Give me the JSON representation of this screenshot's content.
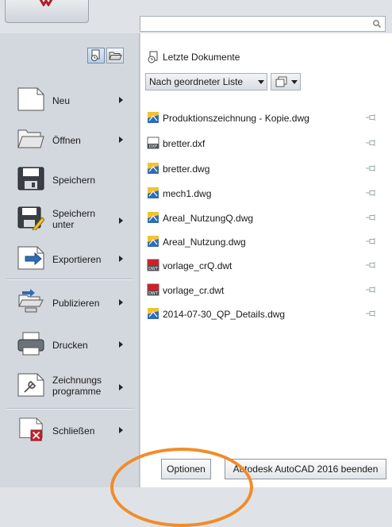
{
  "search": {
    "value": "",
    "placeholder": ""
  },
  "left_menu": {
    "items": [
      {
        "id": "new",
        "label": "Neu",
        "has_submenu": true
      },
      {
        "id": "open",
        "label": "Öffnen",
        "has_submenu": true
      },
      {
        "id": "save",
        "label": "Speichern",
        "has_submenu": false
      },
      {
        "id": "saveas",
        "label": "Speichern unter",
        "has_submenu": true
      },
      {
        "id": "export",
        "label": "Exportieren",
        "has_submenu": true
      },
      {
        "id": "publish",
        "label": "Publizieren",
        "has_submenu": true
      },
      {
        "id": "print",
        "label": "Drucken",
        "has_submenu": true
      },
      {
        "id": "drawingutils",
        "label": "Zeichnungs programme",
        "has_submenu": true
      },
      {
        "id": "close",
        "label": "Schließen",
        "has_submenu": true
      }
    ]
  },
  "recent": {
    "title": "Letzte Dokumente",
    "sort_option": "Nach geordneter Liste",
    "files": [
      {
        "name": "Produktionszeichnung - Kopie.dwg",
        "type": "dwg"
      },
      {
        "name": "bretter.dxf",
        "type": "dxf"
      },
      {
        "name": "bretter.dwg",
        "type": "dwg"
      },
      {
        "name": "mech1.dwg",
        "type": "dwg"
      },
      {
        "name": "Areal_NutzungQ.dwg",
        "type": "dwg"
      },
      {
        "name": "Areal_Nutzung.dwg",
        "type": "dwg"
      },
      {
        "name": "vorlage_crQ.dwt",
        "type": "dwt"
      },
      {
        "name": "vorlage_cr.dwt",
        "type": "dwt"
      },
      {
        "name": "2014-07-30_QP_Details.dwg",
        "type": "dwg"
      }
    ]
  },
  "footer": {
    "options_label": "Optionen",
    "exit_label": "Autodesk AutoCAD 2016 beenden"
  },
  "colors": {
    "highlight": "#f28c28",
    "dwt_red": "#c8232c",
    "dwg_blue": "#2f6db5",
    "accent_yellow": "#f2c230"
  }
}
